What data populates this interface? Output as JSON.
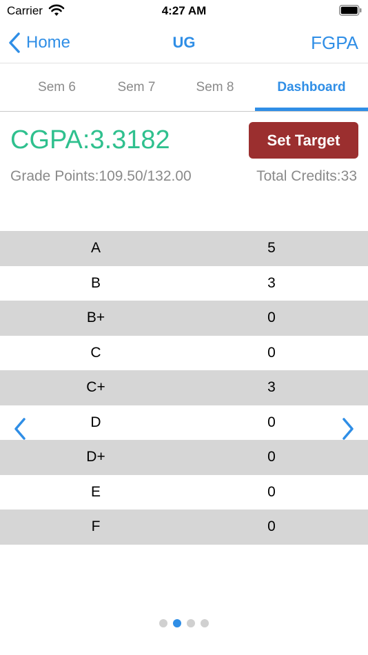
{
  "status": {
    "carrier": "Carrier",
    "time": "4:27 AM"
  },
  "nav": {
    "back_label": "Home",
    "title": "UG",
    "right_label": "FGPA"
  },
  "tabs": [
    {
      "label": "Sem 6",
      "active": false
    },
    {
      "label": "Sem 7",
      "active": false
    },
    {
      "label": "Sem 8",
      "active": false
    },
    {
      "label": "Dashboard",
      "active": true
    }
  ],
  "summary": {
    "cgpa": "CGPA:3.3182",
    "target_button": "Set Target",
    "grade_points": "Grade Points:109.50/132.00",
    "total_credits": "Total Credits:33"
  },
  "grades": [
    {
      "grade": "A",
      "count": "5"
    },
    {
      "grade": "B",
      "count": "3"
    },
    {
      "grade": "B+",
      "count": "0"
    },
    {
      "grade": "C",
      "count": "0"
    },
    {
      "grade": "C+",
      "count": "3"
    },
    {
      "grade": "D",
      "count": "0"
    },
    {
      "grade": "D+",
      "count": "0"
    },
    {
      "grade": "E",
      "count": "0"
    },
    {
      "grade": "F",
      "count": "0"
    }
  ],
  "pager": {
    "total_pages": 4,
    "current_page": 2
  },
  "icons": {
    "back": "chevron-left-icon",
    "prev": "chevron-left-icon",
    "next": "chevron-right-icon",
    "wifi": "wifi-icon",
    "battery": "battery-icon"
  },
  "colors": {
    "accent": "#2f8ee6",
    "cgpa": "#2fc08e",
    "target_button": "#9b2f2f",
    "row_shade": "#d6d6d6",
    "muted_text": "#8a8a8a"
  }
}
